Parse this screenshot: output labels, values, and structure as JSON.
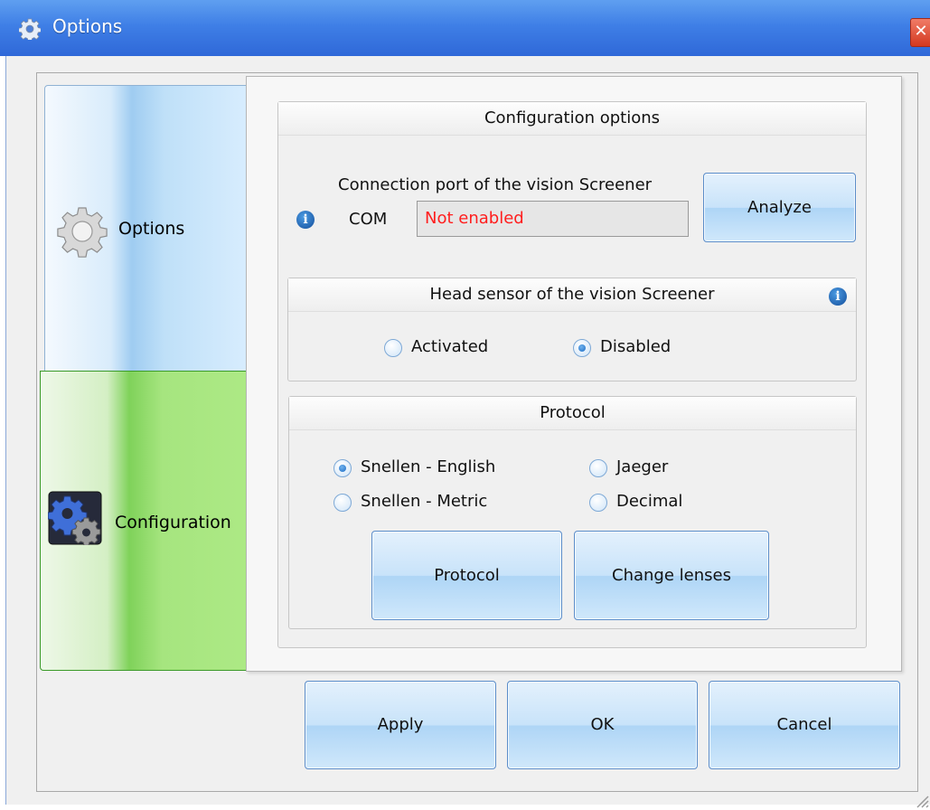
{
  "window": {
    "title": "Options",
    "close_glyph": "✕"
  },
  "nav": [
    {
      "label": "Options",
      "icon": "gear-icon",
      "color": "#bfe0f8"
    },
    {
      "label": "Configuration",
      "icon": "configuration-icon",
      "color": "#7fd25a"
    }
  ],
  "config": {
    "title": "Configuration options",
    "connection_label": "Connection port of the vision Screener",
    "com_label": "COM",
    "com_value": "Not enabled",
    "com_value_color": "#ff1e1e",
    "analyze_button": "Analyze",
    "info_glyph": "i"
  },
  "head_sensor": {
    "title": "Head sensor of the vision Screener",
    "options": [
      {
        "label": "Activated",
        "checked": false
      },
      {
        "label": "Disabled",
        "checked": true
      }
    ]
  },
  "protocol": {
    "title": "Protocol",
    "options": [
      {
        "label": "Snellen - English",
        "checked": true
      },
      {
        "label": "Jaeger",
        "checked": false
      },
      {
        "label": "Snellen - Metric",
        "checked": false
      },
      {
        "label": "Decimal",
        "checked": false
      }
    ],
    "protocol_button": "Protocol",
    "change_lenses_button": "Change lenses"
  },
  "footer": {
    "apply": "Apply",
    "ok": "OK",
    "cancel": "Cancel"
  }
}
